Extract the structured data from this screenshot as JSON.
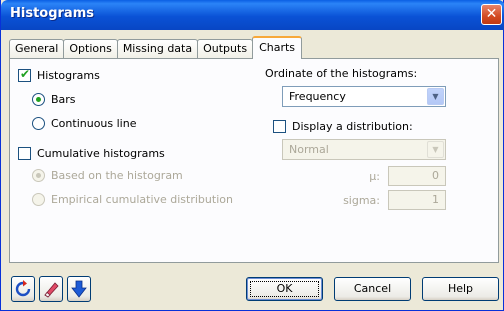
{
  "window": {
    "title": "Histograms",
    "close_glyph": "✕"
  },
  "tabs": [
    {
      "label": "General",
      "active": false
    },
    {
      "label": "Options",
      "active": false
    },
    {
      "label": "Missing data",
      "active": false
    },
    {
      "label": "Outputs",
      "active": false
    },
    {
      "label": "Charts",
      "active": true
    }
  ],
  "left": {
    "histograms": {
      "label": "Histograms",
      "checked": true
    },
    "bars": {
      "label": "Bars",
      "selected": true
    },
    "continuous": {
      "label": "Continuous line",
      "selected": false
    },
    "cumulative": {
      "label": "Cumulative histograms",
      "checked": false
    },
    "based_on": {
      "label": "Based on the histogram",
      "selected": true,
      "disabled": true
    },
    "empirical": {
      "label": "Empirical cumulative distribution",
      "selected": false,
      "disabled": true
    }
  },
  "right": {
    "ordinate_label": "Ordinate of the histograms:",
    "ordinate_value": "Frequency",
    "display_dist": {
      "label": "Display a distribution:",
      "checked": false
    },
    "dist_value": "Normal",
    "mu_label": "µ:",
    "mu_value": "0",
    "sigma_label": "sigma:",
    "sigma_value": "1"
  },
  "buttons": {
    "ok": "OK",
    "cancel": "Cancel",
    "help": "Help"
  },
  "icons": [
    "reset-icon",
    "eraser-icon",
    "down-arrow-icon"
  ],
  "colors": {
    "titlebar": "#0a52d6",
    "accent_check": "#21a121",
    "tab_highlight": "#f7a83a"
  }
}
